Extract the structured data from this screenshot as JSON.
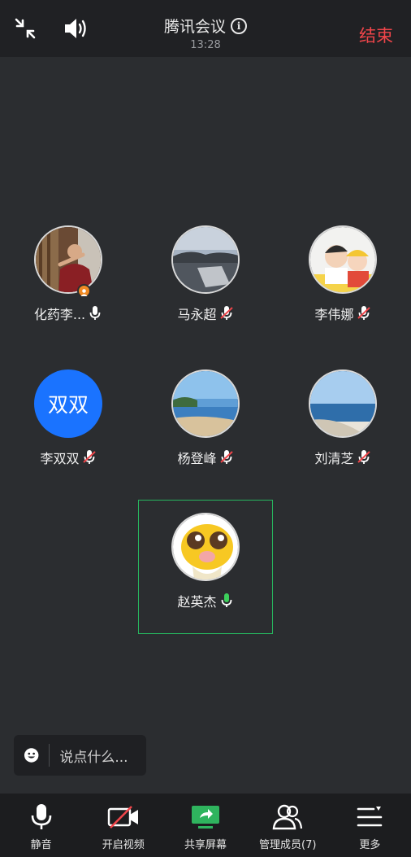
{
  "header": {
    "title": "腾讯会议",
    "time": "13:28",
    "end_label": "结束"
  },
  "participants": [
    {
      "name": "化药李...",
      "mic": "on",
      "host": true,
      "avatar": "photo-person"
    },
    {
      "name": "马永超",
      "mic": "muted",
      "avatar": "photo-sea"
    },
    {
      "name": "李伟娜",
      "mic": "muted",
      "avatar": "photo-kids"
    },
    {
      "name": "李双双",
      "mic": "muted",
      "avatar_text": "双双"
    },
    {
      "name": "杨登峰",
      "mic": "muted",
      "avatar": "photo-beach"
    },
    {
      "name": "刘清芝",
      "mic": "muted",
      "avatar": "photo-pier"
    },
    {
      "name": "赵英杰",
      "mic": "speaking",
      "active": true,
      "avatar": "cartoon-emoji"
    }
  ],
  "chat": {
    "placeholder": "说点什么..."
  },
  "toolbar": {
    "mute_label": "静音",
    "video_label": "开启视频",
    "share_label": "共享屏幕",
    "members_label": "管理成员(7)",
    "more_label": "更多"
  },
  "colors": {
    "accent_green": "#27b55e",
    "end_red": "#f0454a",
    "avatar_blue": "#1a73ff",
    "host_orange": "#f08a24"
  }
}
